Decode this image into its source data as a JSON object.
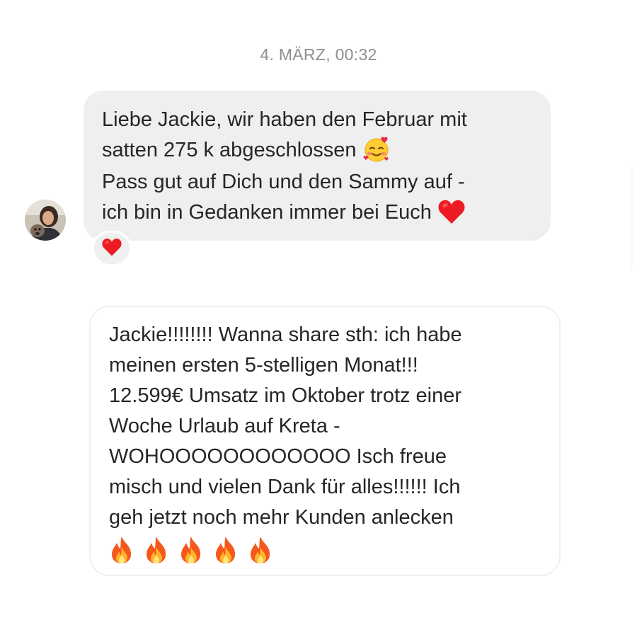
{
  "timestamp": "4. MÄRZ, 00:32",
  "incoming": {
    "lines": [
      "Liebe Jackie, wir haben den Februar mit",
      "satten 275 k abgeschlossen",
      "Pass gut auf Dich und den Sammy auf -",
      "ich bin in Gedanken immer bei Euch"
    ],
    "icons": [
      "smiling-face-with-hearts-icon",
      "red-heart-icon"
    ],
    "reaction": "red-heart-icon"
  },
  "outgoing": {
    "lines": [
      "Jackie!!!!!!!! Wanna share sth: ich habe",
      "meinen ersten 5-stelligen Monat!!!",
      "12.599€ Umsatz im Oktober trotz einer",
      "Woche Urlaub auf Kreta -",
      "WOHOOOOOOOOOOOO Isch freue",
      "misch und vielen Dank für alles!!!!!! Ich",
      "geh jetzt noch mehr Kunden anlecken"
    ],
    "icons": [
      "fire-icon",
      "fire-icon",
      "fire-icon",
      "fire-icon",
      "fire-icon"
    ]
  },
  "colors": {
    "incoming_bubble": "#efefef",
    "outgoing_border": "#efefef",
    "text": "#262626",
    "timestamp": "#8e8e8e",
    "heart": "#ed1c24"
  }
}
